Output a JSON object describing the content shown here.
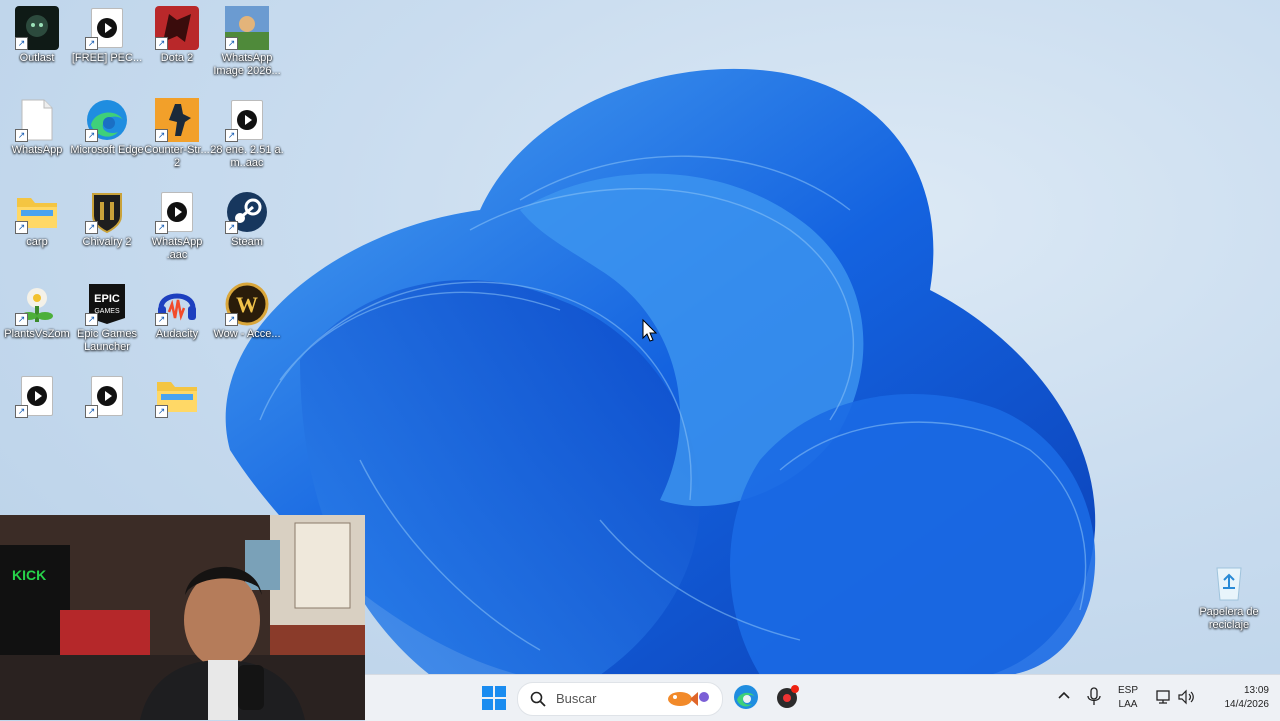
{
  "desktop": {
    "icons": [
      {
        "label": "Outlast",
        "icon": "outlast-icon"
      },
      {
        "label": "[FREE] PEC...",
        "icon": "audio-file-icon"
      },
      {
        "label": "Dota 2",
        "icon": "dota2-icon"
      },
      {
        "label": "WhatsApp Image 2026...",
        "icon": "image-file-icon"
      },
      {
        "label": "WhatsApp",
        "icon": "blank-file-icon"
      },
      {
        "label": "Microsoft Edge",
        "icon": "edge-icon"
      },
      {
        "label": "Counter-Str... 2",
        "icon": "counter-strike-icon"
      },
      {
        "label": "28 ene. 2.51 a. m..aac",
        "icon": "audio-file-icon"
      },
      {
        "label": "carp",
        "icon": "folder-icon"
      },
      {
        "label": "Chivalry 2",
        "icon": "chivalry-icon"
      },
      {
        "label": "WhatsApp .aac",
        "icon": "audio-file-icon"
      },
      {
        "label": "Steam",
        "icon": "steam-icon"
      },
      {
        "label": "PlantsVsZom",
        "icon": "plants-vs-zombies-icon"
      },
      {
        "label": "Epic Games Launcher",
        "icon": "epic-games-icon"
      },
      {
        "label": "Audacity",
        "icon": "audacity-icon"
      },
      {
        "label": "Wow - Acce...",
        "icon": "wow-icon"
      },
      {
        "label": "",
        "icon": "audio-file-icon"
      },
      {
        "label": "",
        "icon": "audio-file-icon"
      },
      {
        "label": "",
        "icon": "folder-icon"
      }
    ],
    "recycle_bin": {
      "label": "Papelera de reciclaje",
      "icon": "recycle-bin-icon"
    }
  },
  "taskbar": {
    "search_placeholder": "Buscar",
    "language": "ESP",
    "layout": "LAA",
    "time": "13:09",
    "date": "14/4/2026"
  },
  "colors": {
    "accent": "#1a73e8",
    "taskbar_bg": "#eef1f5"
  }
}
